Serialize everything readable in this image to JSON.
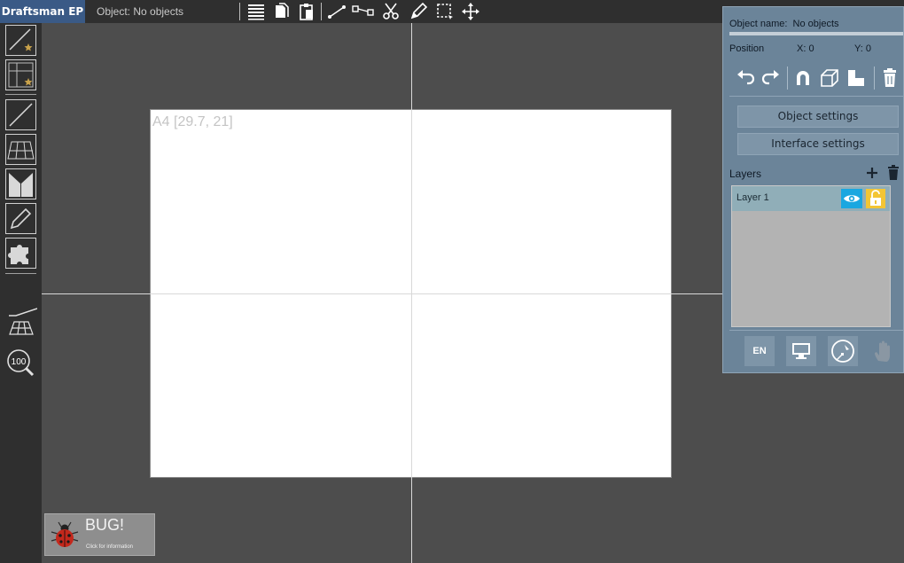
{
  "app": {
    "title": "Draftsman EP",
    "object_status": "Object: No objects"
  },
  "toolbar": {
    "icons": [
      "align-icon",
      "copy-icon",
      "paste-icon",
      "line-icon",
      "connect-icon",
      "scissors-icon",
      "pencil-icon",
      "select-icon",
      "move-icon"
    ]
  },
  "left_toolbar": {
    "icons": [
      "new-line-icon",
      "new-grid-icon",
      "line-tool-icon",
      "perspective-grid-icon",
      "mirror-icon",
      "draw-icon",
      "puzzle-icon",
      "line-angle-icon",
      "grid-perspective-icon",
      "zoom-icon"
    ],
    "zoom_level": "100"
  },
  "canvas": {
    "paper_label": "A4 [29.7, 21]"
  },
  "bug": {
    "title": "BUG!",
    "subtitle": "Click for information"
  },
  "panel": {
    "object_name_label": "Object name:",
    "object_name_value": "No objects",
    "position_label": "Position",
    "x_label": "X: 0",
    "y_label": "Y: 0",
    "tools": [
      "undo-icon",
      "redo-icon",
      "magnet-icon",
      "cube-icon",
      "align-bottom-icon",
      "trash-icon"
    ],
    "object_settings": "Object settings",
    "interface_settings": "Interface settings",
    "layers_label": "Layers",
    "layers": [
      {
        "name": "Layer 1",
        "visible": true,
        "locked": false
      }
    ],
    "footer": {
      "language": "EN"
    }
  },
  "colors": {
    "brand": "#3a5a86",
    "panel": "#6b8499",
    "layer_row": "#90aeb8",
    "eye": "#1aa7e0",
    "lock": "#f3c534"
  }
}
